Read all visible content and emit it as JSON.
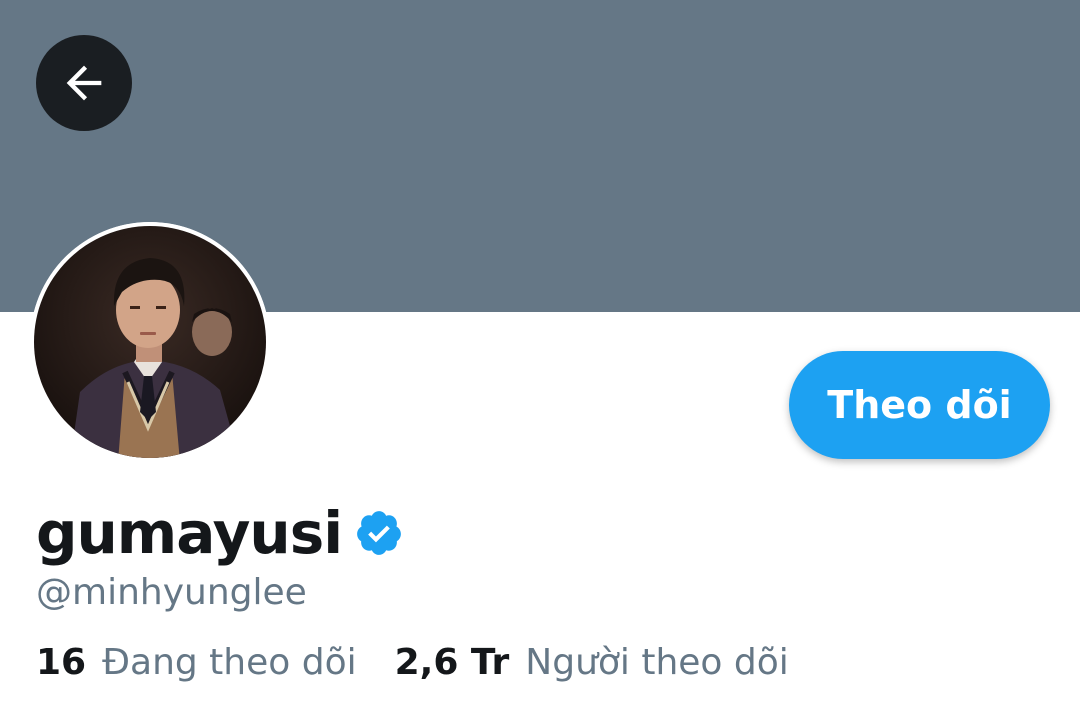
{
  "profile": {
    "display_name": "gumayusi",
    "handle": "@minhyunglee",
    "verified": true,
    "follow_label": "Theo dõi"
  },
  "stats": {
    "following_count": "16",
    "following_label": "Đang theo dõi",
    "followers_count": "2,6 Tr",
    "followers_label": "Người theo dõi"
  },
  "icons": {
    "back": "arrow-left-icon",
    "verified": "verified-badge-icon"
  },
  "colors": {
    "banner": "#657786",
    "accent": "#1da1f2",
    "text_primary": "#14171a",
    "text_secondary": "#657786",
    "back_button": "#1a1e22"
  }
}
